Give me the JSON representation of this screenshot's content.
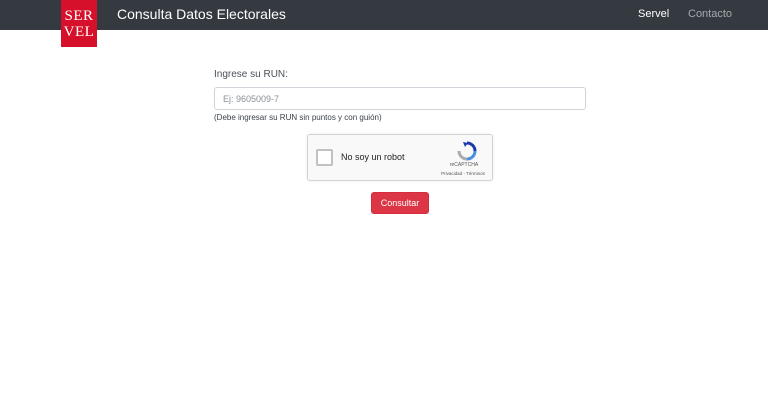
{
  "navbar": {
    "logo_top": "SER",
    "logo_bottom": "VEL",
    "brand": "Consulta Datos Electorales",
    "links": [
      {
        "label": "Servel",
        "active": true
      },
      {
        "label": "Contacto",
        "active": false
      }
    ]
  },
  "form": {
    "label": "Ingrese su RUN:",
    "run_placeholder": "Ej: 9605009-7",
    "run_value": "",
    "help": "(Debe ingresar su RUN sin puntos y con guión)",
    "submit_label": "Consultar"
  },
  "captcha": {
    "label": "No soy un robot",
    "brand": "reCAPTCHA",
    "links": "Privacidad - Términos",
    "checked": false
  },
  "colors": {
    "navbar_bg": "#343a40",
    "logo_bg": "#d6102a",
    "button_bg": "#dc3545"
  },
  "icons": {
    "captcha_logo": "recaptcha-logo-icon"
  }
}
